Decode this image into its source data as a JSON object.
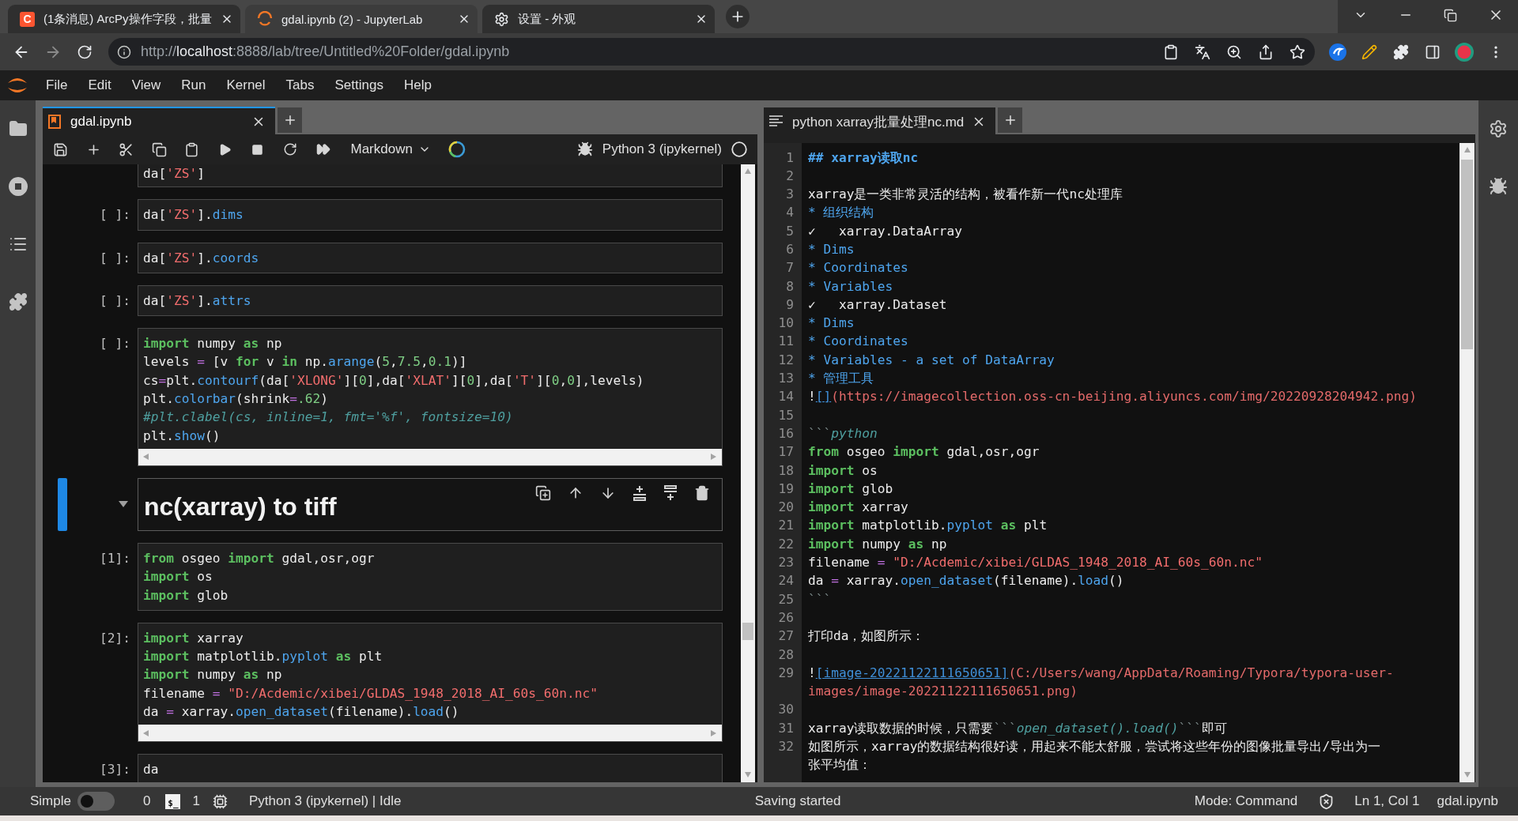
{
  "browser": {
    "tabs": [
      {
        "kind": "letter",
        "badge": "C",
        "title": "(1条消息) ArcPy操作字段，批量",
        "selected": false
      },
      {
        "kind": "spinner",
        "title": "gdal.ipynb (2) - JupyterLab",
        "selected": true
      },
      {
        "kind": "gear",
        "title": "设置 - 外观",
        "selected": false
      }
    ],
    "address": {
      "scheme": "http://",
      "host": "localhost",
      "path": ":8888/lab/tree/Untitled%20Folder/gdal.ipynb"
    }
  },
  "menu": [
    "File",
    "Edit",
    "View",
    "Run",
    "Kernel",
    "Tabs",
    "Settings",
    "Help"
  ],
  "notebook": {
    "tab": {
      "title": "gdal.ipynb",
      "selected": true
    },
    "toolbar": {
      "cell_type": "Markdown",
      "kernel": "Python 3 (ipykernel)"
    },
    "cells": [
      {
        "kind": "code",
        "selected": false,
        "lines": [
          [
            {
              "kind": "plain",
              "text": "da["
            },
            {
              "kind": "string",
              "text": "'ZS'"
            },
            {
              "kind": "plain",
              "text": "]"
            }
          ]
        ]
      },
      {
        "kind": "code",
        "prompt": "[ ]:",
        "selected": false,
        "lines": [
          [
            {
              "kind": "plain",
              "text": "da["
            },
            {
              "kind": "string",
              "text": "'ZS'"
            },
            {
              "kind": "plain",
              "text": "]."
            },
            {
              "kind": "property",
              "text": "dims"
            }
          ]
        ]
      },
      {
        "kind": "code",
        "prompt": "[ ]:",
        "selected": false,
        "lines": [
          [
            {
              "kind": "plain",
              "text": "da["
            },
            {
              "kind": "string",
              "text": "'ZS'"
            },
            {
              "kind": "plain",
              "text": "]."
            },
            {
              "kind": "property",
              "text": "coords"
            }
          ]
        ]
      },
      {
        "kind": "code",
        "prompt": "[ ]:",
        "selected": false,
        "lines": [
          [
            {
              "kind": "plain",
              "text": "da["
            },
            {
              "kind": "string",
              "text": "'ZS'"
            },
            {
              "kind": "plain",
              "text": "]."
            },
            {
              "kind": "property",
              "text": "attrs"
            }
          ]
        ]
      },
      {
        "kind": "code",
        "prompt": "[ ]:",
        "selected": false,
        "h_scrollbar": true,
        "lines": [
          [
            {
              "kind": "keyword",
              "text": "import"
            },
            {
              "kind": "plain",
              "text": " numpy "
            },
            {
              "kind": "keyword",
              "text": "as"
            },
            {
              "kind": "plain",
              "text": " np"
            }
          ],
          [
            {
              "kind": "plain",
              "text": "levels "
            },
            {
              "kind": "operator",
              "text": "="
            },
            {
              "kind": "plain",
              "text": " [v "
            },
            {
              "kind": "keyword",
              "text": "for"
            },
            {
              "kind": "plain",
              "text": " v "
            },
            {
              "kind": "keyword",
              "text": "in"
            },
            {
              "kind": "plain",
              "text": " np."
            },
            {
              "kind": "property",
              "text": "arange"
            },
            {
              "kind": "plain",
              "text": "("
            },
            {
              "kind": "number",
              "text": "5"
            },
            {
              "kind": "plain",
              "text": ","
            },
            {
              "kind": "number",
              "text": "7.5"
            },
            {
              "kind": "plain",
              "text": ","
            },
            {
              "kind": "number",
              "text": "0.1"
            },
            {
              "kind": "plain",
              "text": ")]"
            }
          ],
          [
            {
              "kind": "plain",
              "text": "cs"
            },
            {
              "kind": "operator",
              "text": "="
            },
            {
              "kind": "plain",
              "text": "plt."
            },
            {
              "kind": "property",
              "text": "contourf"
            },
            {
              "kind": "plain",
              "text": "(da["
            },
            {
              "kind": "string",
              "text": "'XLONG'"
            },
            {
              "kind": "plain",
              "text": "]["
            },
            {
              "kind": "number",
              "text": "0"
            },
            {
              "kind": "plain",
              "text": "],da["
            },
            {
              "kind": "string",
              "text": "'XLAT'"
            },
            {
              "kind": "plain",
              "text": "]["
            },
            {
              "kind": "number",
              "text": "0"
            },
            {
              "kind": "plain",
              "text": "],da["
            },
            {
              "kind": "string",
              "text": "'T'"
            },
            {
              "kind": "plain",
              "text": "]["
            },
            {
              "kind": "number",
              "text": "0"
            },
            {
              "kind": "plain",
              "text": ","
            },
            {
              "kind": "number",
              "text": "0"
            },
            {
              "kind": "plain",
              "text": "],levels)"
            }
          ],
          [
            {
              "kind": "plain",
              "text": "plt."
            },
            {
              "kind": "property",
              "text": "colorbar"
            },
            {
              "kind": "plain",
              "text": "(shrink"
            },
            {
              "kind": "operator",
              "text": "="
            },
            {
              "kind": "number",
              "text": ".62"
            },
            {
              "kind": "plain",
              "text": ")"
            }
          ],
          [
            {
              "kind": "comment",
              "text": "#plt.clabel(cs, inline=1, fmt='%f', fontsize=10)"
            }
          ],
          [
            {
              "kind": "plain",
              "text": "plt."
            },
            {
              "kind": "property",
              "text": "show"
            },
            {
              "kind": "plain",
              "text": "()"
            }
          ]
        ]
      },
      {
        "kind": "markdown",
        "heading": "nc(xarray) to tiff",
        "expanded": true,
        "selected": true
      },
      {
        "kind": "code",
        "prompt": "[1]:",
        "selected": false,
        "lines": [
          [
            {
              "kind": "keyword",
              "text": "from"
            },
            {
              "kind": "plain",
              "text": " osgeo "
            },
            {
              "kind": "keyword",
              "text": "import"
            },
            {
              "kind": "plain",
              "text": " gdal,osr,ogr"
            }
          ],
          [
            {
              "kind": "keyword",
              "text": "import"
            },
            {
              "kind": "plain",
              "text": " os"
            }
          ],
          [
            {
              "kind": "keyword",
              "text": "import"
            },
            {
              "kind": "plain",
              "text": " glob"
            }
          ]
        ]
      },
      {
        "kind": "code",
        "prompt": "[2]:",
        "selected": false,
        "h_scrollbar": true,
        "lines": [
          [
            {
              "kind": "keyword",
              "text": "import"
            },
            {
              "kind": "plain",
              "text": " xarray"
            }
          ],
          [
            {
              "kind": "keyword",
              "text": "import"
            },
            {
              "kind": "plain",
              "text": " matplotlib."
            },
            {
              "kind": "property",
              "text": "pyplot"
            },
            {
              "kind": "keyword",
              "text": " as"
            },
            {
              "kind": "plain",
              "text": " plt"
            }
          ],
          [
            {
              "kind": "keyword",
              "text": "import"
            },
            {
              "kind": "plain",
              "text": " numpy "
            },
            {
              "kind": "keyword",
              "text": "as"
            },
            {
              "kind": "plain",
              "text": " np"
            }
          ],
          [
            {
              "kind": "plain",
              "text": "filename "
            },
            {
              "kind": "operator",
              "text": "="
            },
            {
              "kind": "string",
              "text": " \"D:/Acdemic/xibei/GLDAS_1948_2018_AI_60s_60n.nc\""
            }
          ],
          [
            {
              "kind": "plain",
              "text": "da "
            },
            {
              "kind": "operator",
              "text": "="
            },
            {
              "kind": "plain",
              "text": " xarray."
            },
            {
              "kind": "property",
              "text": "open_dataset"
            },
            {
              "kind": "plain",
              "text": "(filename)."
            },
            {
              "kind": "property",
              "text": "load"
            },
            {
              "kind": "plain",
              "text": "()"
            }
          ]
        ]
      },
      {
        "kind": "code",
        "prompt": "[3]:",
        "selected": false,
        "lines": [
          [
            {
              "kind": "plain",
              "text": "da"
            }
          ]
        ]
      }
    ]
  },
  "editor": {
    "tab": {
      "title": "python xarray批量处理nc.md",
      "selected": false
    },
    "lines": [
      {
        "number": "1",
        "tokens": [
          {
            "kind": "heading",
            "text": "## xarray读取nc"
          }
        ]
      },
      {
        "number": "2"
      },
      {
        "number": "3",
        "tokens": [
          {
            "kind": "plain",
            "text": "xarray是一类非常灵活的结构，被看作新一代nc处理库"
          }
        ]
      },
      {
        "number": "4",
        "tokens": [
          {
            "kind": "list",
            "text": "* 组织结构"
          }
        ]
      },
      {
        "number": "5",
        "tokens": [
          {
            "kind": "plain",
            "text": "✓   xarray.DataArray"
          }
        ]
      },
      {
        "number": "6",
        "tokens": [
          {
            "kind": "list",
            "text": "* Dims"
          }
        ]
      },
      {
        "number": "7",
        "tokens": [
          {
            "kind": "list",
            "text": "* Coordinates"
          }
        ]
      },
      {
        "number": "8",
        "tokens": [
          {
            "kind": "list",
            "text": "* Variables"
          }
        ]
      },
      {
        "number": "9",
        "tokens": [
          {
            "kind": "plain",
            "text": "✓   xarray.Dataset"
          }
        ]
      },
      {
        "number": "10",
        "tokens": [
          {
            "kind": "list",
            "text": "* Dims"
          }
        ]
      },
      {
        "number": "11",
        "tokens": [
          {
            "kind": "list",
            "text": "* Coordinates"
          }
        ]
      },
      {
        "number": "12",
        "tokens": [
          {
            "kind": "list",
            "text": "* Variables - a set of DataArray"
          }
        ]
      },
      {
        "number": "13",
        "tokens": [
          {
            "kind": "list",
            "text": "* 管理工具"
          }
        ]
      },
      {
        "number": "14",
        "tokens": [
          {
            "kind": "plain",
            "text": "!"
          },
          {
            "kind": "link",
            "text": "[]"
          },
          {
            "kind": "url",
            "text": "(https://imagecollection.oss-cn-beijing.aliyuncs.com/img/20220928204942.png)"
          }
        ]
      },
      {
        "number": "15"
      },
      {
        "number": "16",
        "tokens": [
          {
            "kind": "fence",
            "text": "```"
          },
          {
            "kind": "emphasis",
            "text": "python"
          }
        ]
      },
      {
        "number": "17",
        "tokens": [
          {
            "kind": "keyword",
            "text": "from"
          },
          {
            "kind": "plain",
            "text": " osgeo "
          },
          {
            "kind": "keyword",
            "text": "import"
          },
          {
            "kind": "plain",
            "text": " gdal,osr,ogr"
          }
        ]
      },
      {
        "number": "18",
        "tokens": [
          {
            "kind": "keyword",
            "text": "import"
          },
          {
            "kind": "plain",
            "text": " os"
          }
        ]
      },
      {
        "number": "19",
        "tokens": [
          {
            "kind": "keyword",
            "text": "import"
          },
          {
            "kind": "plain",
            "text": " glob"
          }
        ]
      },
      {
        "number": "20",
        "tokens": [
          {
            "kind": "keyword",
            "text": "import"
          },
          {
            "kind": "plain",
            "text": " xarray"
          }
        ]
      },
      {
        "number": "21",
        "tokens": [
          {
            "kind": "keyword",
            "text": "import"
          },
          {
            "kind": "plain",
            "text": " matplotlib."
          },
          {
            "kind": "property",
            "text": "pyplot"
          },
          {
            "kind": "keyword",
            "text": " as"
          },
          {
            "kind": "plain",
            "text": " plt"
          }
        ]
      },
      {
        "number": "22",
        "tokens": [
          {
            "kind": "keyword",
            "text": "import"
          },
          {
            "kind": "plain",
            "text": " numpy "
          },
          {
            "kind": "keyword",
            "text": "as"
          },
          {
            "kind": "plain",
            "text": " np"
          }
        ]
      },
      {
        "number": "23",
        "tokens": [
          {
            "kind": "plain",
            "text": "filename "
          },
          {
            "kind": "operator",
            "text": "="
          },
          {
            "kind": "string",
            "text": " \"D:/Acdemic/xibei/GLDAS_1948_2018_AI_60s_60n.nc\""
          }
        ]
      },
      {
        "number": "24",
        "tokens": [
          {
            "kind": "plain",
            "text": "da "
          },
          {
            "kind": "operator",
            "text": "="
          },
          {
            "kind": "plain",
            "text": " xarray."
          },
          {
            "kind": "property",
            "text": "open_dataset"
          },
          {
            "kind": "plain",
            "text": "(filename)."
          },
          {
            "kind": "property",
            "text": "load"
          },
          {
            "kind": "plain",
            "text": "()"
          }
        ]
      },
      {
        "number": "25",
        "tokens": [
          {
            "kind": "fence",
            "text": "```"
          }
        ]
      },
      {
        "number": "26"
      },
      {
        "number": "27",
        "tokens": [
          {
            "kind": "plain",
            "text": "打印da，如图所示："
          }
        ]
      },
      {
        "number": "28"
      },
      {
        "number": "29",
        "tokens": [
          {
            "kind": "plain",
            "text": "!"
          },
          {
            "kind": "link",
            "text": "[image-20221122111650651]"
          },
          {
            "kind": "url",
            "text": "(C:/Users/wang/AppData/Roaming/Typora/typora-user-"
          }
        ],
        "wrap": [
          {
            "kind": "url",
            "text": "images/image-20221122111650651.png)"
          }
        ]
      },
      {
        "number": "30"
      },
      {
        "number": "31",
        "tokens": [
          {
            "kind": "plain",
            "text": "xarray读取数据的时候，只需要"
          },
          {
            "kind": "fence",
            "text": "```"
          },
          {
            "kind": "emphasis",
            "text": "open_dataset().load()"
          },
          {
            "kind": "fence",
            "text": "```"
          },
          {
            "kind": "plain",
            "text": "即可"
          }
        ]
      },
      {
        "number": "32",
        "tokens": [
          {
            "kind": "plain",
            "text": "如图所示，xarray的数据结构很好读，用起来不能太舒服，尝试将这些年份的图像批量导出/导出为一"
          }
        ],
        "wrap": [
          {
            "kind": "plain",
            "text": "张平均值："
          }
        ]
      }
    ]
  },
  "status_bar": {
    "mode_label": "Simple",
    "simple_mode": false,
    "terminals": "0",
    "terminal_badge": "$_",
    "kernels": "1",
    "kernel_status": "Python 3 (ipykernel) | Idle",
    "message": "Saving started",
    "mode": "Mode: Command",
    "cursor": "Ln 1, Col 1",
    "file": "gdal.ipynb"
  }
}
